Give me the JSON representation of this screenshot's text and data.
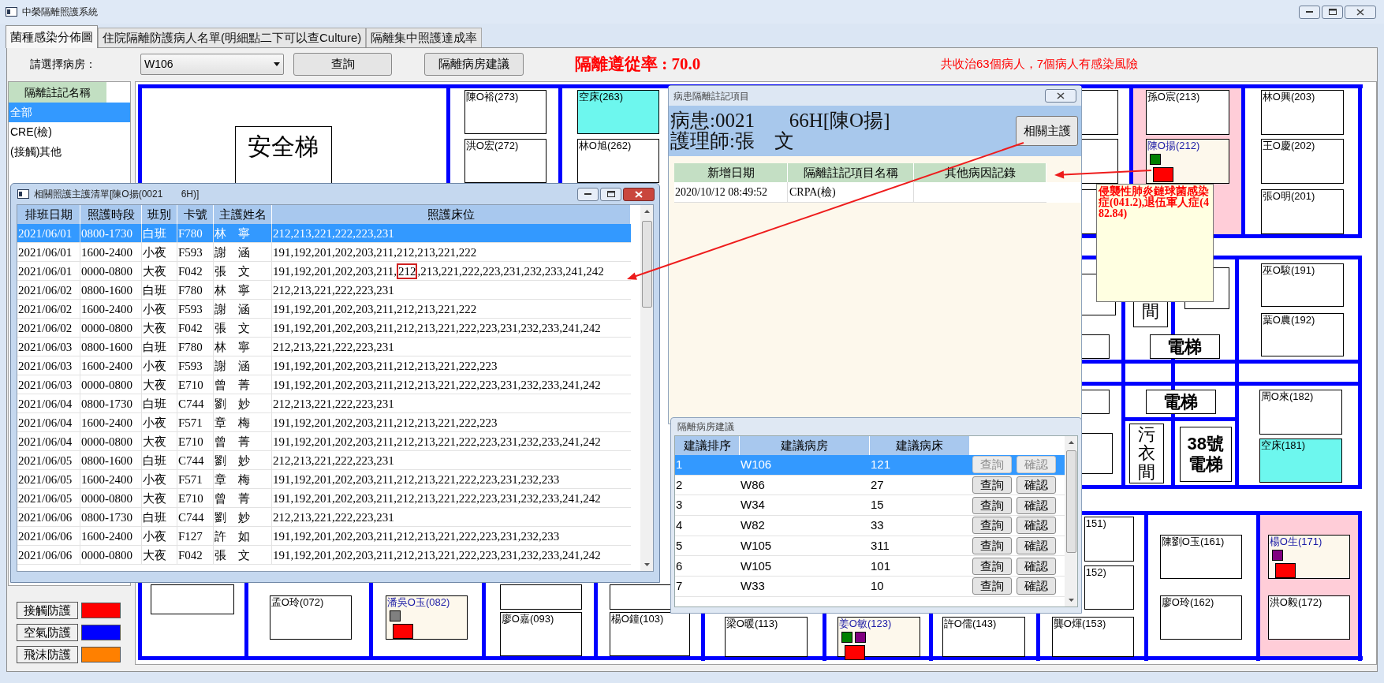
{
  "window": {
    "title": "中榮隔離照護系統"
  },
  "tabs": [
    {
      "label": "菌種感染分佈圖",
      "selected": true
    },
    {
      "label": "住院隔離防護病人名單(明細點二下可以查Culture)",
      "selected": false
    },
    {
      "label": "隔離集中照護達成率",
      "selected": false
    }
  ],
  "toolbar": {
    "ward_label": "請選擇病房：",
    "ward_value": "W106",
    "query_button": "查詢",
    "suggest_button": "隔離病房建議",
    "compliance": "隔離遵從率 : 70.0",
    "summary": "共收治63個病人，7個病人有感染風險"
  },
  "sidebar": {
    "header": "隔離註記名稱",
    "items": [
      {
        "label": "全部",
        "selected": true
      },
      {
        "label": "CRE(檢)",
        "selected": false
      },
      {
        "label": "(接觸)其他",
        "selected": false
      }
    ],
    "legend": [
      {
        "label": "接觸防護",
        "color": "#ff0000"
      },
      {
        "label": "空氣防護",
        "color": "#0000ff"
      },
      {
        "label": "飛沫防護",
        "color": "#ff8000"
      }
    ]
  },
  "floor_plan": {
    "zones": [
      {
        "alert": true
      },
      {
        "alert": true
      }
    ],
    "fixtures": [
      {
        "kind": "stairs",
        "label": "安全梯"
      },
      {
        "kind": "elevator",
        "label": "電梯"
      },
      {
        "kind": "elevator",
        "label": "電梯"
      },
      {
        "kind": "room",
        "label": "污衣間"
      },
      {
        "kind": "elevator",
        "label": "38號電梯"
      },
      {
        "kind": "room",
        "label": "間"
      }
    ],
    "rooms": [
      {
        "kind": "patient",
        "label": "陳O裕(273)"
      },
      {
        "kind": "empty_bed",
        "label": "空床(263)"
      },
      {
        "kind": "patient",
        "label": "孫O宸(213)"
      },
      {
        "kind": "patient",
        "label": "林O興(203)"
      },
      {
        "kind": "patient",
        "label": "洪O宏(272)"
      },
      {
        "kind": "patient",
        "label": "林O旭(262)"
      },
      {
        "kind": "flagged",
        "label": "陳O揚(212)",
        "markers": [
          {
            "kind": "note",
            "color": "#008000"
          },
          {
            "kind": "precaution",
            "color": "#ff0000"
          }
        ]
      },
      {
        "kind": "patient",
        "label": "王O慶(202)"
      },
      {
        "kind": "patient",
        "label": "張O明(201)"
      },
      {
        "kind": "patient",
        "label": "巫O駿(191)"
      },
      {
        "kind": "patient",
        "label": "葉O農(192)"
      },
      {
        "kind": "patient",
        "label": "周O來(182)"
      },
      {
        "kind": "empty_bed",
        "label": "空床(181)"
      },
      {
        "kind": "patient",
        "label": "151)"
      },
      {
        "kind": "patient",
        "label": "陳劉O玉(161)"
      },
      {
        "kind": "flagged",
        "label": "楊O生(171)",
        "markers": [
          {
            "kind": "note",
            "color": "#800080"
          },
          {
            "kind": "precaution",
            "color": "#ff0000"
          }
        ]
      },
      {
        "kind": "patient",
        "label": "152)"
      },
      {
        "kind": "patient",
        "label": "孟O玲(072)"
      },
      {
        "kind": "flagged",
        "label": "潘吳O玉(082)",
        "markers": [
          {
            "kind": "note",
            "color": "#808080"
          },
          {
            "kind": "precaution",
            "color": "#ff0000"
          }
        ]
      },
      {
        "kind": "patient",
        "label": "廖O玲(162)"
      },
      {
        "kind": "patient",
        "label": "洪O毅(172)"
      },
      {
        "kind": "patient",
        "label": "廖O嘉(093)"
      },
      {
        "kind": "patient",
        "label": "楊O鐘(103)"
      },
      {
        "kind": "patient",
        "label": "梁O暖(113)"
      },
      {
        "kind": "flagged",
        "label": "姜O敏(123)",
        "markers": [
          {
            "kind": "note",
            "color": "#008000"
          },
          {
            "kind": "note",
            "color": "#800080"
          },
          {
            "kind": "precaution",
            "color": "#ff0000"
          }
        ]
      },
      {
        "kind": "patient",
        "label": "許O儒(143)"
      },
      {
        "kind": "patient",
        "label": "龔O煇(153)"
      }
    ]
  },
  "tooltip": {
    "text": "侵襲性肺炎鏈球菌感染症(041.2),退伍軍人症(482.84)"
  },
  "nurse_window": {
    "title": "相關照護主護清單[陳O揚(0021       6H)]",
    "columns": [
      "排班日期",
      "照護時段",
      "班別",
      "卡號",
      "主護姓名",
      "照護床位"
    ],
    "rows": [
      {
        "date": "2021/06/01",
        "period": "0800-1730",
        "shift": "白班",
        "card": "F780",
        "nurse": "林　寧",
        "beds": "212,213,221,222,223,231",
        "selected": true
      },
      {
        "date": "2021/06/01",
        "period": "1600-2400",
        "shift": "小夜",
        "card": "F593",
        "nurse": "謝　涵",
        "beds": "191,192,201,202,203,211,212,213,221,222",
        "selected": false
      },
      {
        "date": "2021/06/01",
        "period": "0000-0800",
        "shift": "大夜",
        "card": "F042",
        "nurse": "張　文",
        "beds": [
          {
            "text": "191,192,201,202,203,211,",
            "circled": false
          },
          {
            "text": "212",
            "circled": true
          },
          {
            "text": ",213,221,222,223,231,232,233,241,242",
            "circled": false
          }
        ],
        "selected": false
      },
      {
        "date": "2021/06/02",
        "period": "0800-1600",
        "shift": "白班",
        "card": "F780",
        "nurse": "林　寧",
        "beds": "212,213,221,222,223,231",
        "selected": false
      },
      {
        "date": "2021/06/02",
        "period": "1600-2400",
        "shift": "小夜",
        "card": "F593",
        "nurse": "謝　涵",
        "beds": "191,192,201,202,203,211,212,213,221,222",
        "selected": false
      },
      {
        "date": "2021/06/02",
        "period": "0000-0800",
        "shift": "大夜",
        "card": "F042",
        "nurse": "張　文",
        "beds": "191,192,201,202,203,211,212,213,221,222,223,231,232,233,241,242",
        "selected": false
      },
      {
        "date": "2021/06/03",
        "period": "0800-1600",
        "shift": "白班",
        "card": "F780",
        "nurse": "林　寧",
        "beds": "212,213,221,222,223,231",
        "selected": false
      },
      {
        "date": "2021/06/03",
        "period": "1600-2400",
        "shift": "小夜",
        "card": "F593",
        "nurse": "謝　涵",
        "beds": "191,192,201,202,203,211,212,213,221,222,223",
        "selected": false
      },
      {
        "date": "2021/06/03",
        "period": "0000-0800",
        "shift": "大夜",
        "card": "E710",
        "nurse": "曾　菁",
        "beds": "191,192,201,202,203,211,212,213,221,222,223,231,232,233,241,242",
        "selected": false
      },
      {
        "date": "2021/06/04",
        "period": "0800-1730",
        "shift": "白班",
        "card": "C744",
        "nurse": "劉　妙",
        "beds": "212,213,221,222,223,231",
        "selected": false
      },
      {
        "date": "2021/06/04",
        "period": "1600-2400",
        "shift": "小夜",
        "card": "F571",
        "nurse": "章　梅",
        "beds": "191,192,201,202,203,211,212,213,221,222,223",
        "selected": false
      },
      {
        "date": "2021/06/04",
        "period": "0000-0800",
        "shift": "大夜",
        "card": "E710",
        "nurse": "曾　菁",
        "beds": "191,192,201,202,203,211,212,213,221,222,223,231,232,233,241,242",
        "selected": false
      },
      {
        "date": "2021/06/05",
        "period": "0800-1600",
        "shift": "白班",
        "card": "C744",
        "nurse": "劉　妙",
        "beds": "212,213,221,222,223,231",
        "selected": false
      },
      {
        "date": "2021/06/05",
        "period": "1600-2400",
        "shift": "小夜",
        "card": "F571",
        "nurse": "章　梅",
        "beds": "191,192,201,202,203,211,212,213,221,222,223,231,232,233",
        "selected": false
      },
      {
        "date": "2021/06/05",
        "period": "0000-0800",
        "shift": "大夜",
        "card": "E710",
        "nurse": "曾　菁",
        "beds": "191,192,201,202,203,211,212,213,221,222,223,231,232,233,241,242",
        "selected": false
      },
      {
        "date": "2021/06/06",
        "period": "0800-1730",
        "shift": "白班",
        "card": "C744",
        "nurse": "劉　妙",
        "beds": "212,213,221,222,223,231",
        "selected": false
      },
      {
        "date": "2021/06/06",
        "period": "1600-2400",
        "shift": "小夜",
        "card": "F127",
        "nurse": "許　如",
        "beds": "191,192,201,202,203,211,212,213,221,222,223,231,232,233",
        "selected": false
      },
      {
        "date": "2021/06/06",
        "period": "0000-0800",
        "shift": "大夜",
        "card": "F042",
        "nurse": "張　文",
        "beds": "191,192,201,202,203,211,212,213,221,222,223,231,232,233,241,242",
        "selected": false
      }
    ]
  },
  "note_window": {
    "title": "病患隔離註記項目",
    "patient": "病患:0021       66H[陳O揚]",
    "nurse": "護理師:張　文",
    "button": "相關主護",
    "columns": [
      "新增日期",
      "隔離註記項目名稱",
      "其他病因記錄"
    ],
    "rows": [
      {
        "date": "2020/10/12 08:49:52",
        "item": "CRPA(檢)"
      }
    ]
  },
  "suggestion_window": {
    "title": "隔離病房建議",
    "columns": [
      "建議排序",
      "建議病房",
      "建議病床"
    ],
    "rows": [
      {
        "rank": "1",
        "ward": "W106",
        "bed": "121",
        "query": "查詢",
        "confirm": "確認",
        "selected": true,
        "disabled": true
      },
      {
        "rank": "2",
        "ward": "W86",
        "bed": "27",
        "query": "查詢",
        "confirm": "確認",
        "selected": false,
        "disabled": false
      },
      {
        "rank": "3",
        "ward": "W34",
        "bed": "15",
        "query": "查詢",
        "confirm": "確認",
        "selected": false,
        "disabled": false
      },
      {
        "rank": "4",
        "ward": "W82",
        "bed": "33",
        "query": "查詢",
        "confirm": "確認",
        "selected": false,
        "disabled": false
      },
      {
        "rank": "5",
        "ward": "W105",
        "bed": "311",
        "query": "查詢",
        "confirm": "確認",
        "selected": false,
        "disabled": false
      },
      {
        "rank": "6",
        "ward": "W105",
        "bed": "101",
        "query": "查詢",
        "confirm": "確認",
        "selected": false,
        "disabled": false
      },
      {
        "rank": "7",
        "ward": "W33",
        "bed": "10",
        "query": "查詢",
        "confirm": "確認",
        "selected": false,
        "disabled": false
      }
    ]
  }
}
